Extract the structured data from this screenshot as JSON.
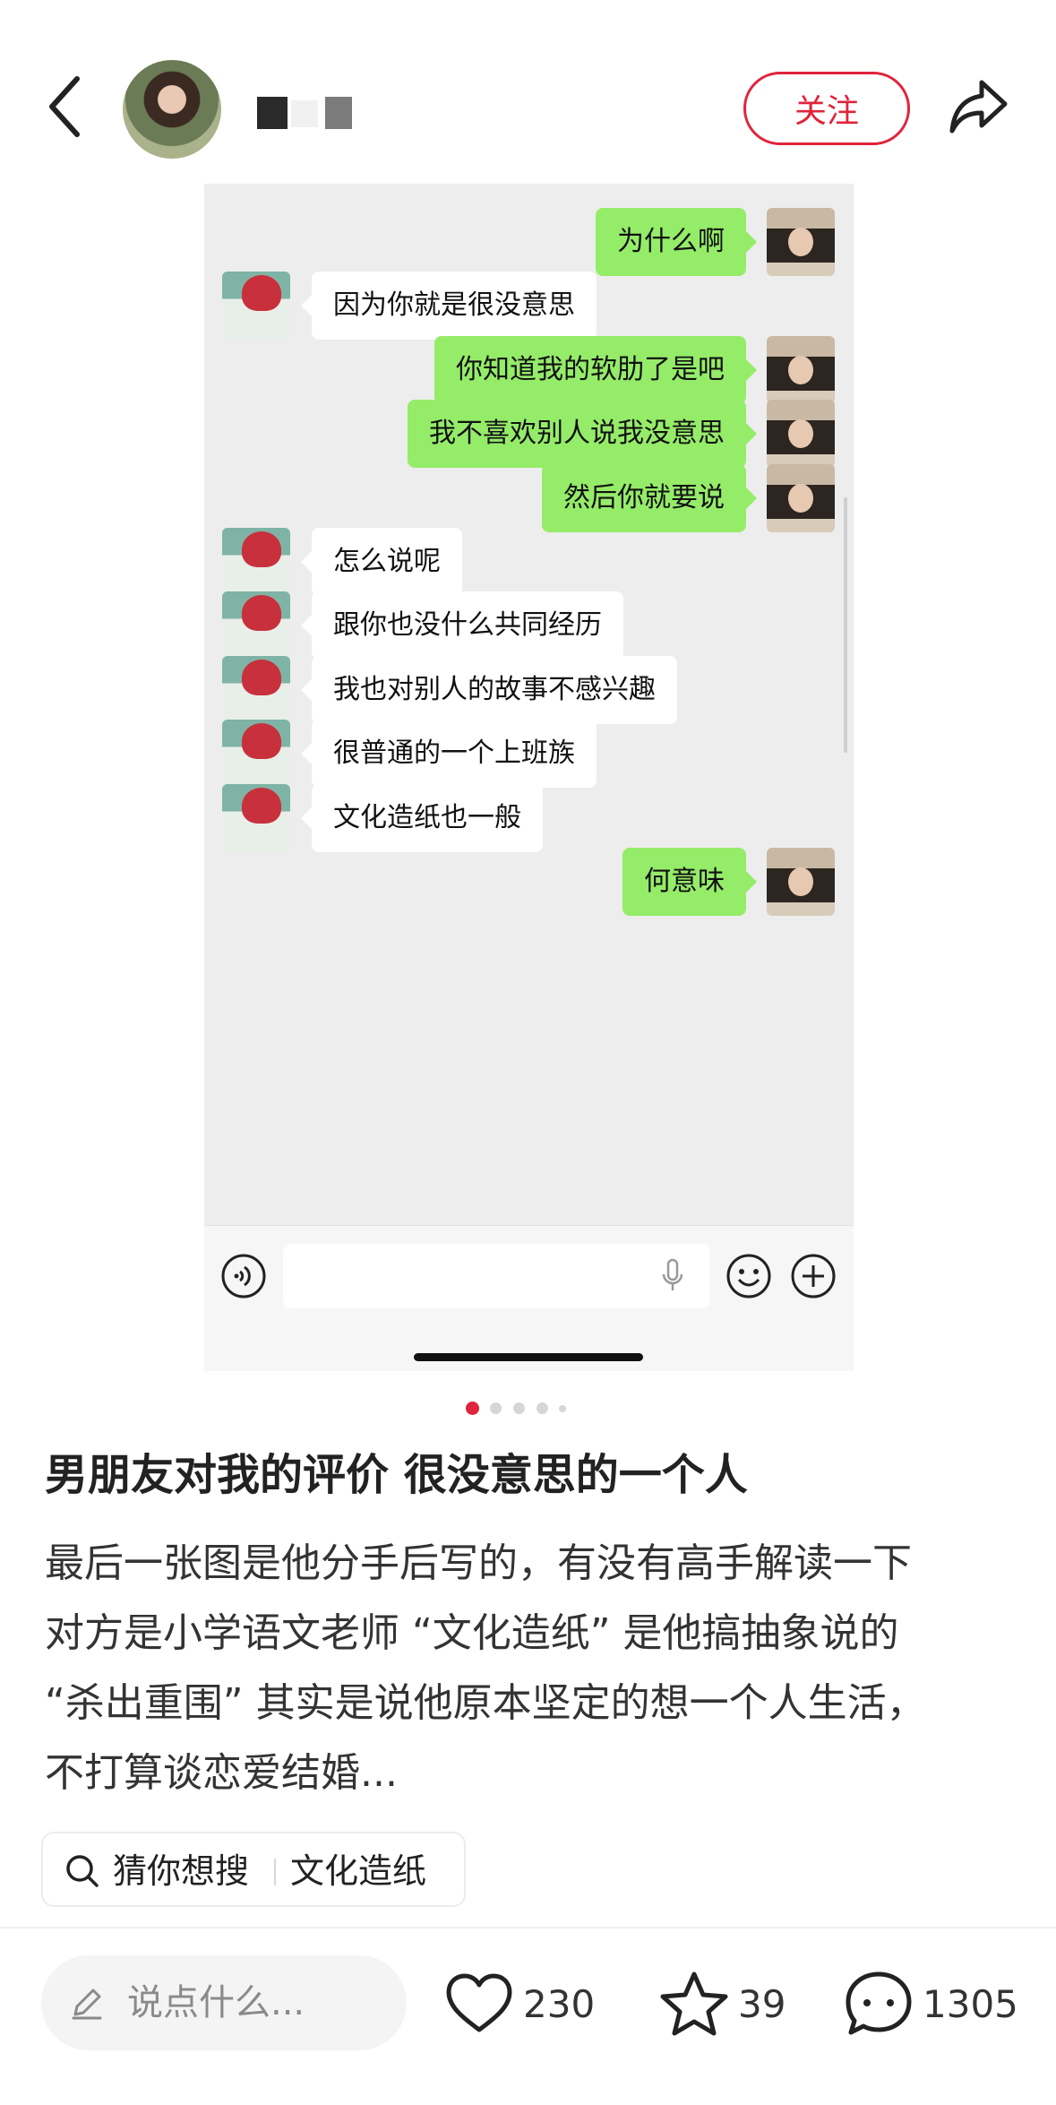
{
  "header": {
    "follow_label": "关注"
  },
  "chat": {
    "messages": [
      {
        "sender": "me",
        "text": "为什么啊"
      },
      {
        "sender": "boyfriend",
        "text": "因为你就是很没意思"
      },
      {
        "sender": "me",
        "text": "你知道我的软肋了是吧"
      },
      {
        "sender": "me",
        "text": "我不喜欢别人说我没意思"
      },
      {
        "sender": "me",
        "text": "然后你就要说"
      },
      {
        "sender": "boyfriend",
        "text": "怎么说呢"
      },
      {
        "sender": "boyfriend",
        "text": "跟你也没什么共同经历"
      },
      {
        "sender": "boyfriend",
        "text": "我也对别人的故事不感兴趣"
      },
      {
        "sender": "boyfriend",
        "text": "很普通的一个上班族"
      },
      {
        "sender": "boyfriend",
        "text": "文化造纸也一般"
      },
      {
        "sender": "me",
        "text": "何意味"
      }
    ]
  },
  "carousel": {
    "total": 5,
    "active_index": 0
  },
  "post": {
    "title": "男朋友对我的评价 很没意思的一个人",
    "description_lines": [
      "最后一张图是他分手后写的，有没有高手解读一下",
      "对方是小学语文老师 “文化造纸” 是他搞抽象说的",
      "“杀出重围” 其实是说他原本坚定的想一个人生活，",
      "不打算谈恋爱结婚..."
    ]
  },
  "guess_search": {
    "label": "猜你想搜",
    "term": "文化造纸"
  },
  "bottom_bar": {
    "comment_placeholder": "说点什么...",
    "likes": "230",
    "favorites": "39",
    "comments": "1305"
  },
  "colors": {
    "accent_red": "#e0243b",
    "bubble_green": "#95ec69",
    "chat_background": "#ededed"
  },
  "icons": [
    "back-arrow-icon",
    "share-icon",
    "voice-icon",
    "mic-icon",
    "emoji-icon",
    "plus-icon",
    "search-icon",
    "pen-icon",
    "heart-icon",
    "star-icon",
    "comment-icon"
  ]
}
